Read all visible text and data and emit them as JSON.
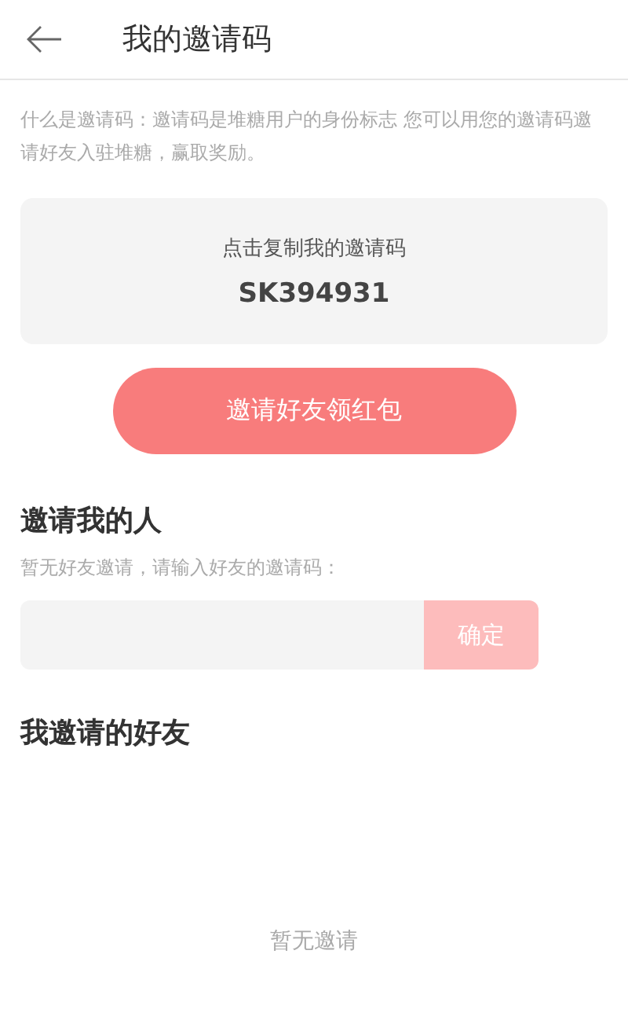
{
  "header": {
    "title": "我的邀请码"
  },
  "intro": "什么是邀请码：邀请码是堆糖用户的身份标志 您可以用您的邀请码邀请好友入驻堆糖，赢取奖励。",
  "code_card": {
    "hint": "点击复制我的邀请码",
    "code": "SK394931"
  },
  "invite_button": "邀请好友领红包",
  "inviter": {
    "heading": "邀请我的人",
    "note": "暂无好友邀请，请输入好友的邀请码：",
    "confirm": {
      "label": "确定",
      "disabled": true
    }
  },
  "friends": {
    "heading": "我邀请的好友",
    "empty": "暂无邀请"
  }
}
